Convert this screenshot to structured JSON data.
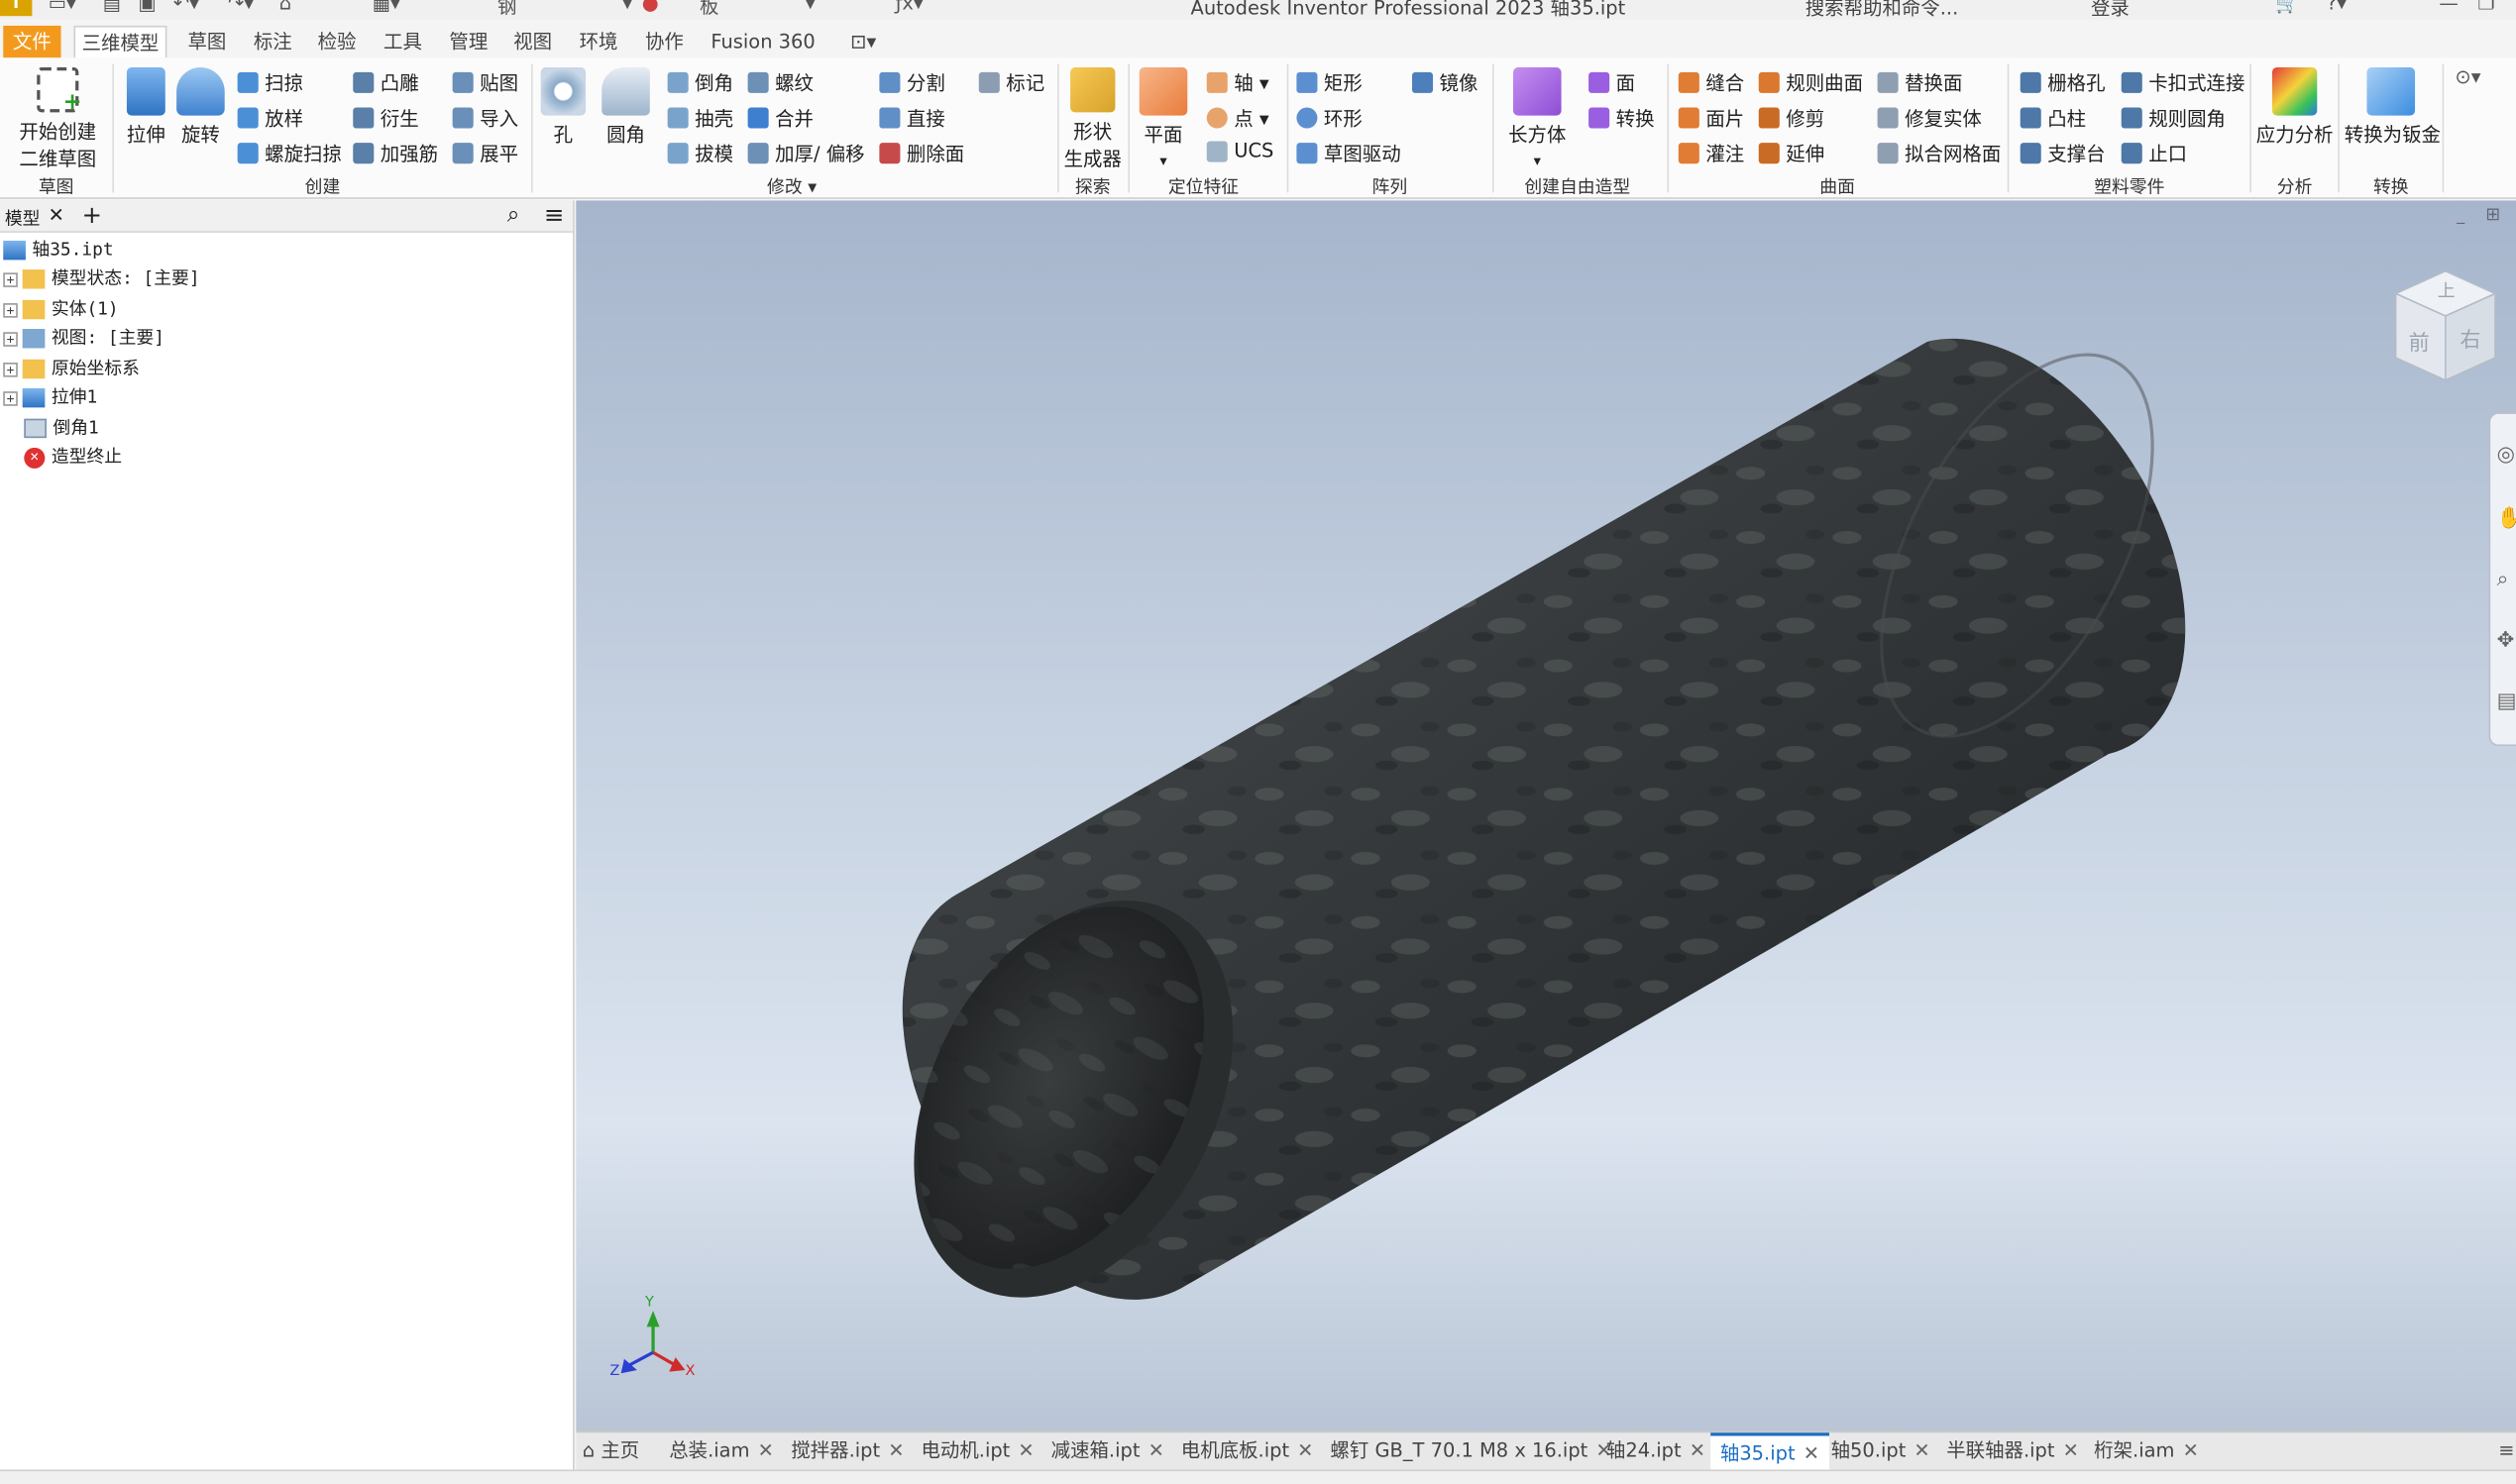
{
  "titlebar": {
    "app_logo": "I",
    "material": "钢",
    "appearance": "板",
    "title": "Autodesk Inventor Professional 2023    轴35.ipt",
    "help_search": "搜索帮助和命令...",
    "login": "登录"
  },
  "menu": {
    "file": "文件",
    "tabs": [
      "三维模型",
      "草图",
      "标注",
      "检验",
      "工具",
      "管理",
      "视图",
      "环境",
      "协作",
      "Fusion 360"
    ]
  },
  "ribbon": {
    "sketch": {
      "start": "开始创建",
      "start2": "二维草图",
      "group": "草图"
    },
    "create": {
      "extrude": "拉伸",
      "revolve": "旋转",
      "sweep": "扫掠",
      "loft": "放样",
      "coil": "螺旋扫掠",
      "emboss": "凸雕",
      "derive": "衍生",
      "rib": "加强筋",
      "decal": "贴图",
      "import": "导入",
      "unfold": "展平",
      "group": "创建"
    },
    "modify": {
      "hole": "孔",
      "fillet": "圆角",
      "chamfer": "倒角",
      "shell": "抽壳",
      "draft": "拔模",
      "thread": "螺纹",
      "combine": "合并",
      "thicken": "加厚/ 偏移",
      "split": "分割",
      "direct": "直接",
      "delete_face": "删除面",
      "mark": "标记",
      "group": "修改"
    },
    "explore": {
      "shape_gen": "形状",
      "shape_gen2": "生成器",
      "group": "探索"
    },
    "work": {
      "plane": "平面",
      "axis": "轴",
      "point": "点",
      "ucs": "UCS",
      "group": "定位特征"
    },
    "pattern": {
      "rect": "矩形",
      "circ": "环形",
      "sketch_driven": "草图驱动",
      "mirror": "镜像",
      "group": "阵列"
    },
    "freeform": {
      "box": "长方体",
      "face": "面",
      "convert": "转换",
      "group": "创建自由造型"
    },
    "surface": {
      "stitch": "缝合",
      "patch": "面片",
      "sculpt": "灌注",
      "ruled": "规则曲面",
      "trim": "修剪",
      "extend": "延伸",
      "replace": "替换面",
      "repair": "修复实体",
      "fit_mesh": "拟合网格面",
      "group": "曲面"
    },
    "plastic": {
      "grill": "栅格孔",
      "boss": "凸柱",
      "rest": "支撑台",
      "snap": "卡扣式连接",
      "rule_fillet": "规则圆角",
      "lip": "止口",
      "group": "塑料零件"
    },
    "analysis": {
      "stress": "应力分析",
      "group": "分析"
    },
    "convert": {
      "sheet": "转换为钣金",
      "group": "转换"
    }
  },
  "browser": {
    "tab": "模型",
    "items": [
      "轴35.ipt",
      "模型状态: [主要]",
      "实体(1)",
      "视图: [主要]",
      "原始坐标系",
      "拉伸1",
      "倒角1",
      "造型终止"
    ]
  },
  "viewcube": {
    "top": "上",
    "front": "前",
    "right": "右"
  },
  "triad": {
    "x": "X",
    "y": "Y",
    "z": "Z"
  },
  "doctabs": [
    {
      "label": "主页"
    },
    {
      "label": "总装.iam"
    },
    {
      "label": "搅拌器.ipt"
    },
    {
      "label": "电动机.ipt"
    },
    {
      "label": "减速箱.ipt"
    },
    {
      "label": "电机底板.ipt"
    },
    {
      "label": "螺钉 GB_T 70.1 M8 x 16.ipt"
    },
    {
      "label": "轴24.ipt"
    },
    {
      "label": "轴35.ipt"
    },
    {
      "label": "轴50.ipt"
    },
    {
      "label": "半联轴器.ipt"
    },
    {
      "label": "桁架.iam"
    }
  ],
  "colors": {
    "file_tab": "#f39a1e",
    "active_doc": "#1a6ec4",
    "viewport_top": "#a6b5cc",
    "viewport_bottom": "#dbe4ef"
  }
}
